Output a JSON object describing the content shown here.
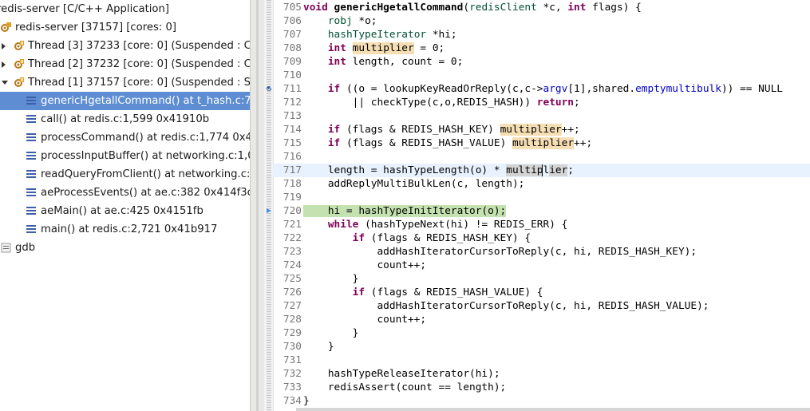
{
  "debug_tree": [
    {
      "label": "redis-server [C/C++ Application]",
      "indent": -6,
      "icon": "none",
      "twisty": "none",
      "selected": false
    },
    {
      "label": "redis-server [37157] [cores: 0]",
      "indent": 0,
      "icon": "process-icon",
      "twisty": "none",
      "selected": false
    },
    {
      "label": "Thread [3] 37233 [core: 0] (Suspended : Co",
      "indent": 16,
      "icon": "thread-icon",
      "twisty": "right",
      "selected": false
    },
    {
      "label": "Thread [2] 37232 [core: 0] (Suspended : Co",
      "indent": 16,
      "icon": "thread-icon",
      "twisty": "right",
      "selected": false
    },
    {
      "label": "Thread [1] 37157 [core: 0] (Suspended : St",
      "indent": 16,
      "icon": "thread-icon",
      "twisty": "down",
      "selected": false
    },
    {
      "label": "genericHgetallCommand() at t_hash.c:7",
      "indent": 32,
      "icon": "stack-frame-icon",
      "twisty": "none",
      "selected": true
    },
    {
      "label": "call() at redis.c:1,599 0x41910b",
      "indent": 32,
      "icon": "stack-frame-icon",
      "twisty": "none",
      "selected": false
    },
    {
      "label": "processCommand() at redis.c:1,774 0x4",
      "indent": 32,
      "icon": "stack-frame-icon",
      "twisty": "none",
      "selected": false
    },
    {
      "label": "processInputBuffer() at networking.c:1,0",
      "indent": 32,
      "icon": "stack-frame-icon",
      "twisty": "none",
      "selected": false
    },
    {
      "label": "readQueryFromClient() at networking.c:",
      "indent": 32,
      "icon": "stack-frame-icon",
      "twisty": "none",
      "selected": false
    },
    {
      "label": "aeProcessEvents() at ae.c:382 0x414f3c",
      "indent": 32,
      "icon": "stack-frame-icon",
      "twisty": "none",
      "selected": false
    },
    {
      "label": "aeMain() at ae.c:425 0x4151fb",
      "indent": 32,
      "icon": "stack-frame-icon",
      "twisty": "none",
      "selected": false
    },
    {
      "label": "main() at redis.c:2,721 0x41b917",
      "indent": 32,
      "icon": "stack-frame-icon",
      "twisty": "none",
      "selected": false
    },
    {
      "label": "gdb",
      "indent": 0,
      "icon": "gdb-icon",
      "twisty": "none",
      "selected": false
    }
  ],
  "code_lines": [
    {
      "n": "705",
      "marker": "none",
      "cls": "",
      "segs": [
        [
          "kw",
          "void"
        ],
        [
          "",
          " "
        ],
        [
          "fn",
          "genericHgetallCommand"
        ],
        [
          "",
          "("
        ],
        [
          "typ",
          "redisClient"
        ],
        [
          "",
          " *c, "
        ],
        [
          "kw",
          "int"
        ],
        [
          "",
          " flags) {"
        ]
      ]
    },
    {
      "n": "706",
      "marker": "none",
      "cls": "",
      "segs": [
        [
          "",
          "    "
        ],
        [
          "typ",
          "robj"
        ],
        [
          "",
          " *o;"
        ]
      ]
    },
    {
      "n": "707",
      "marker": "none",
      "cls": "",
      "segs": [
        [
          "",
          "    "
        ],
        [
          "typ",
          "hashTypeIterator"
        ],
        [
          "",
          " *hi;"
        ]
      ]
    },
    {
      "n": "708",
      "marker": "none",
      "cls": "",
      "segs": [
        [
          "",
          "    "
        ],
        [
          "kw",
          "int"
        ],
        [
          "",
          " "
        ],
        [
          "occ",
          "multiplier"
        ],
        [
          "",
          " = 0;"
        ]
      ]
    },
    {
      "n": "709",
      "marker": "none",
      "cls": "",
      "segs": [
        [
          "",
          "    "
        ],
        [
          "kw",
          "int"
        ],
        [
          "",
          " length, count = 0;"
        ]
      ]
    },
    {
      "n": "710",
      "marker": "none",
      "cls": "",
      "segs": []
    },
    {
      "n": "711",
      "marker": "breakpoint",
      "cls": "",
      "segs": [
        [
          "",
          "    "
        ],
        [
          "kw",
          "if"
        ],
        [
          "",
          " ((o = lookupKeyReadOrReply(c,c->"
        ],
        [
          "fld",
          "argv"
        ],
        [
          "",
          "[1],shared."
        ],
        [
          "fld",
          "emptymultibulk"
        ],
        [
          "",
          ")) == NULL"
        ]
      ]
    },
    {
      "n": "712",
      "marker": "none",
      "cls": "",
      "segs": [
        [
          "",
          "        || checkType(c,o,REDIS_HASH)) "
        ],
        [
          "kw",
          "return"
        ],
        [
          "",
          ";"
        ]
      ]
    },
    {
      "n": "713",
      "marker": "none",
      "cls": "",
      "segs": []
    },
    {
      "n": "714",
      "marker": "none",
      "cls": "",
      "segs": [
        [
          "",
          "    "
        ],
        [
          "kw",
          "if"
        ],
        [
          "",
          " (flags & REDIS_HASH_KEY) "
        ],
        [
          "occ",
          "multiplier"
        ],
        [
          "",
          "++;"
        ]
      ]
    },
    {
      "n": "715",
      "marker": "none",
      "cls": "",
      "segs": [
        [
          "",
          "    "
        ],
        [
          "kw",
          "if"
        ],
        [
          "",
          " (flags & REDIS_HASH_VALUE) "
        ],
        [
          "occ",
          "multiplier"
        ],
        [
          "",
          "++;"
        ]
      ]
    },
    {
      "n": "716",
      "marker": "none",
      "cls": "",
      "segs": []
    },
    {
      "n": "717",
      "marker": "none",
      "cls": "cur",
      "segs": [
        [
          "",
          "    length = hashTypeLength(o) * "
        ],
        [
          "occ2",
          "multip"
        ],
        [
          "caret",
          "l"
        ],
        [
          "occ2",
          "ier"
        ],
        [
          "",
          ";"
        ]
      ]
    },
    {
      "n": "718",
      "marker": "none",
      "cls": "",
      "segs": [
        [
          "",
          "    addReplyMultiBulkLen(c, length);"
        ]
      ]
    },
    {
      "n": "719",
      "marker": "none",
      "cls": "",
      "segs": []
    },
    {
      "n": "720",
      "marker": "pc",
      "cls": "pc",
      "segs": [
        [
          "pcbg",
          "    hi = hashTypeInitIterator(o);"
        ]
      ]
    },
    {
      "n": "721",
      "marker": "none",
      "cls": "",
      "segs": [
        [
          "",
          "    "
        ],
        [
          "kw",
          "while"
        ],
        [
          "",
          " (hashTypeNext(hi) != REDIS_ERR) {"
        ]
      ]
    },
    {
      "n": "722",
      "marker": "none",
      "cls": "",
      "segs": [
        [
          "",
          "        "
        ],
        [
          "kw",
          "if"
        ],
        [
          "",
          " (flags & REDIS_HASH_KEY) {"
        ]
      ]
    },
    {
      "n": "723",
      "marker": "none",
      "cls": "",
      "segs": [
        [
          "",
          "            addHashIteratorCursorToReply(c, hi, REDIS_HASH_KEY);"
        ]
      ]
    },
    {
      "n": "724",
      "marker": "none",
      "cls": "",
      "segs": [
        [
          "",
          "            count++;"
        ]
      ]
    },
    {
      "n": "725",
      "marker": "none",
      "cls": "",
      "segs": [
        [
          "",
          "        }"
        ]
      ]
    },
    {
      "n": "726",
      "marker": "none",
      "cls": "",
      "segs": [
        [
          "",
          "        "
        ],
        [
          "kw",
          "if"
        ],
        [
          "",
          " (flags & REDIS_HASH_VALUE) {"
        ]
      ]
    },
    {
      "n": "727",
      "marker": "none",
      "cls": "",
      "segs": [
        [
          "",
          "            addHashIteratorCursorToReply(c, hi, REDIS_HASH_VALUE);"
        ]
      ]
    },
    {
      "n": "728",
      "marker": "none",
      "cls": "",
      "segs": [
        [
          "",
          "            count++;"
        ]
      ]
    },
    {
      "n": "729",
      "marker": "none",
      "cls": "",
      "segs": [
        [
          "",
          "        }"
        ]
      ]
    },
    {
      "n": "730",
      "marker": "none",
      "cls": "",
      "segs": [
        [
          "",
          "    }"
        ]
      ]
    },
    {
      "n": "731",
      "marker": "none",
      "cls": "",
      "segs": []
    },
    {
      "n": "732",
      "marker": "none",
      "cls": "",
      "segs": [
        [
          "",
          "    hashTypeReleaseIterator(hi);"
        ]
      ]
    },
    {
      "n": "733",
      "marker": "none",
      "cls": "",
      "segs": [
        [
          "",
          "    redisAssert(count == length);"
        ]
      ]
    },
    {
      "n": "734",
      "marker": "none",
      "cls": "",
      "segs": [
        [
          "",
          "}"
        ]
      ]
    }
  ]
}
